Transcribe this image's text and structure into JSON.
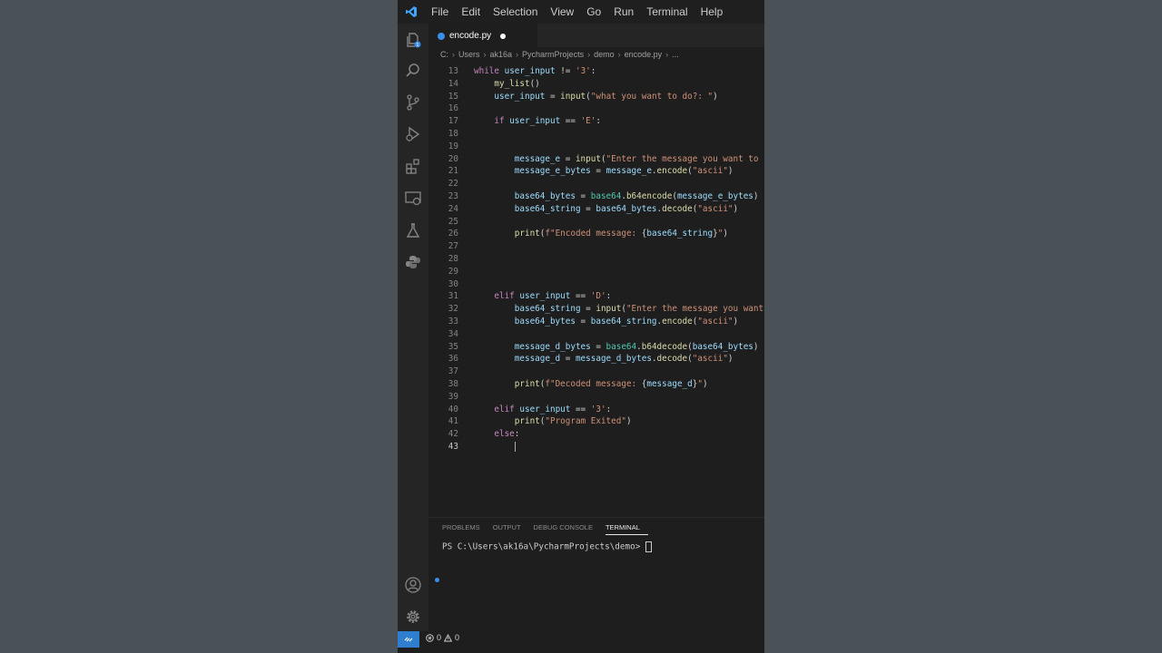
{
  "menubar": {
    "items": [
      "File",
      "Edit",
      "Selection",
      "View",
      "Go",
      "Run",
      "Terminal",
      "Help"
    ]
  },
  "activity_bar": {
    "icons": [
      "explorer-icon",
      "search-icon",
      "source-control-icon",
      "run-debug-icon",
      "extensions-icon",
      "remote-explorer-icon",
      "testing-icon",
      "python-icon"
    ],
    "bottom_icons": [
      "account-icon",
      "settings-gear-icon"
    ],
    "badge_color": "#3b8eea"
  },
  "tab": {
    "label": "encode.py"
  },
  "breadcrumb": [
    "C:",
    "Users",
    "ak16a",
    "PycharmProjects",
    "demo",
    "encode.py",
    "..."
  ],
  "editor": {
    "lines": [
      {
        "n": "13",
        "tokens": [
          [
            "kw",
            "while"
          ],
          [
            "op",
            " "
          ],
          [
            "var",
            "user_input"
          ],
          [
            "op",
            " != "
          ],
          [
            "str",
            "'3'"
          ],
          [
            "op",
            ":"
          ]
        ]
      },
      {
        "n": "14",
        "tokens": [
          [
            "op",
            "    "
          ],
          [
            "fn",
            "my_list"
          ],
          [
            "op",
            "()"
          ]
        ]
      },
      {
        "n": "15",
        "tokens": [
          [
            "op",
            "    "
          ],
          [
            "var",
            "user_input"
          ],
          [
            "op",
            " = "
          ],
          [
            "fn",
            "input"
          ],
          [
            "op",
            "("
          ],
          [
            "str",
            "\"what you want to do?: \""
          ],
          [
            "op",
            ")"
          ]
        ]
      },
      {
        "n": "16",
        "tokens": []
      },
      {
        "n": "17",
        "tokens": [
          [
            "op",
            "    "
          ],
          [
            "kw",
            "if"
          ],
          [
            "op",
            " "
          ],
          [
            "var",
            "user_input"
          ],
          [
            "op",
            " == "
          ],
          [
            "str",
            "'E'"
          ],
          [
            "op",
            ":"
          ]
        ]
      },
      {
        "n": "18",
        "tokens": []
      },
      {
        "n": "19",
        "tokens": []
      },
      {
        "n": "20",
        "tokens": [
          [
            "op",
            "        "
          ],
          [
            "var",
            "message_e"
          ],
          [
            "op",
            " = "
          ],
          [
            "fn",
            "input"
          ],
          [
            "op",
            "("
          ],
          [
            "str",
            "\"Enter the message you want to"
          ]
        ]
      },
      {
        "n": "21",
        "tokens": [
          [
            "op",
            "        "
          ],
          [
            "var",
            "message_e_bytes"
          ],
          [
            "op",
            " = "
          ],
          [
            "var",
            "message_e"
          ],
          [
            "op",
            "."
          ],
          [
            "fn",
            "encode"
          ],
          [
            "op",
            "("
          ],
          [
            "str",
            "\"ascii\""
          ],
          [
            "op",
            ")"
          ]
        ]
      },
      {
        "n": "22",
        "tokens": []
      },
      {
        "n": "23",
        "tokens": [
          [
            "op",
            "        "
          ],
          [
            "var",
            "base64_bytes"
          ],
          [
            "op",
            " = "
          ],
          [
            "cls",
            "base64"
          ],
          [
            "op",
            "."
          ],
          [
            "fn",
            "b64encode"
          ],
          [
            "op",
            "("
          ],
          [
            "var",
            "message_e_bytes"
          ],
          [
            "op",
            ")"
          ]
        ]
      },
      {
        "n": "24",
        "tokens": [
          [
            "op",
            "        "
          ],
          [
            "var",
            "base64_string"
          ],
          [
            "op",
            " = "
          ],
          [
            "var",
            "base64_bytes"
          ],
          [
            "op",
            "."
          ],
          [
            "fn",
            "decode"
          ],
          [
            "op",
            "("
          ],
          [
            "str",
            "\"ascii\""
          ],
          [
            "op",
            ")"
          ]
        ]
      },
      {
        "n": "25",
        "tokens": []
      },
      {
        "n": "26",
        "tokens": [
          [
            "op",
            "        "
          ],
          [
            "fn",
            "print"
          ],
          [
            "op",
            "("
          ],
          [
            "str",
            "f\"Encoded message: "
          ],
          [
            "op",
            "{"
          ],
          [
            "var",
            "base64_string"
          ],
          [
            "op",
            "}"
          ],
          [
            "str",
            "\""
          ],
          [
            "op",
            ")"
          ]
        ]
      },
      {
        "n": "27",
        "tokens": []
      },
      {
        "n": "28",
        "tokens": []
      },
      {
        "n": "29",
        "tokens": []
      },
      {
        "n": "30",
        "tokens": []
      },
      {
        "n": "31",
        "tokens": [
          [
            "op",
            "    "
          ],
          [
            "kw",
            "elif"
          ],
          [
            "op",
            " "
          ],
          [
            "var",
            "user_input"
          ],
          [
            "op",
            " == "
          ],
          [
            "str",
            "'D'"
          ],
          [
            "op",
            ":"
          ]
        ]
      },
      {
        "n": "32",
        "tokens": [
          [
            "op",
            "        "
          ],
          [
            "var",
            "base64_string"
          ],
          [
            "op",
            " = "
          ],
          [
            "fn",
            "input"
          ],
          [
            "op",
            "("
          ],
          [
            "str",
            "\"Enter the message you want"
          ]
        ]
      },
      {
        "n": "33",
        "tokens": [
          [
            "op",
            "        "
          ],
          [
            "var",
            "base64_bytes"
          ],
          [
            "op",
            " = "
          ],
          [
            "var",
            "base64_string"
          ],
          [
            "op",
            "."
          ],
          [
            "fn",
            "encode"
          ],
          [
            "op",
            "("
          ],
          [
            "str",
            "\"ascii\""
          ],
          [
            "op",
            ")"
          ]
        ]
      },
      {
        "n": "34",
        "tokens": []
      },
      {
        "n": "35",
        "tokens": [
          [
            "op",
            "        "
          ],
          [
            "var",
            "message_d_bytes"
          ],
          [
            "op",
            " = "
          ],
          [
            "cls",
            "base64"
          ],
          [
            "op",
            "."
          ],
          [
            "fn",
            "b64decode"
          ],
          [
            "op",
            "("
          ],
          [
            "var",
            "base64_bytes"
          ],
          [
            "op",
            ")"
          ]
        ]
      },
      {
        "n": "36",
        "tokens": [
          [
            "op",
            "        "
          ],
          [
            "var",
            "message_d"
          ],
          [
            "op",
            " = "
          ],
          [
            "var",
            "message_d_bytes"
          ],
          [
            "op",
            "."
          ],
          [
            "fn",
            "decode"
          ],
          [
            "op",
            "("
          ],
          [
            "str",
            "\"ascii\""
          ],
          [
            "op",
            ")"
          ]
        ]
      },
      {
        "n": "37",
        "tokens": []
      },
      {
        "n": "38",
        "tokens": [
          [
            "op",
            "        "
          ],
          [
            "fn",
            "print"
          ],
          [
            "op",
            "("
          ],
          [
            "str",
            "f\"Decoded message: "
          ],
          [
            "op",
            "{"
          ],
          [
            "var",
            "message_d"
          ],
          [
            "op",
            "}"
          ],
          [
            "str",
            "\""
          ],
          [
            "op",
            ")"
          ]
        ]
      },
      {
        "n": "39",
        "tokens": []
      },
      {
        "n": "40",
        "tokens": [
          [
            "op",
            "    "
          ],
          [
            "kw",
            "elif"
          ],
          [
            "op",
            " "
          ],
          [
            "var",
            "user_input"
          ],
          [
            "op",
            " == "
          ],
          [
            "str",
            "'3'"
          ],
          [
            "op",
            ":"
          ]
        ]
      },
      {
        "n": "41",
        "tokens": [
          [
            "op",
            "        "
          ],
          [
            "fn",
            "print"
          ],
          [
            "op",
            "("
          ],
          [
            "str",
            "\"Program Exited\""
          ],
          [
            "op",
            ")"
          ]
        ]
      },
      {
        "n": "42",
        "tokens": [
          [
            "op",
            "    "
          ],
          [
            "kw",
            "else"
          ],
          [
            "op",
            ":"
          ]
        ]
      },
      {
        "n": "43",
        "tokens": [
          [
            "op",
            "        "
          ]
        ],
        "cursor": true,
        "active": true
      }
    ]
  },
  "panel": {
    "tabs": [
      "PROBLEMS",
      "OUTPUT",
      "DEBUG CONSOLE",
      "TERMINAL"
    ],
    "active_tab": "TERMINAL",
    "terminal_prompt": "PS C:\\Users\\ak16a\\PycharmProjects\\demo> "
  },
  "statusbar": {
    "errors": "0",
    "warnings": "0",
    "remote_color": "#2f7fd1"
  }
}
